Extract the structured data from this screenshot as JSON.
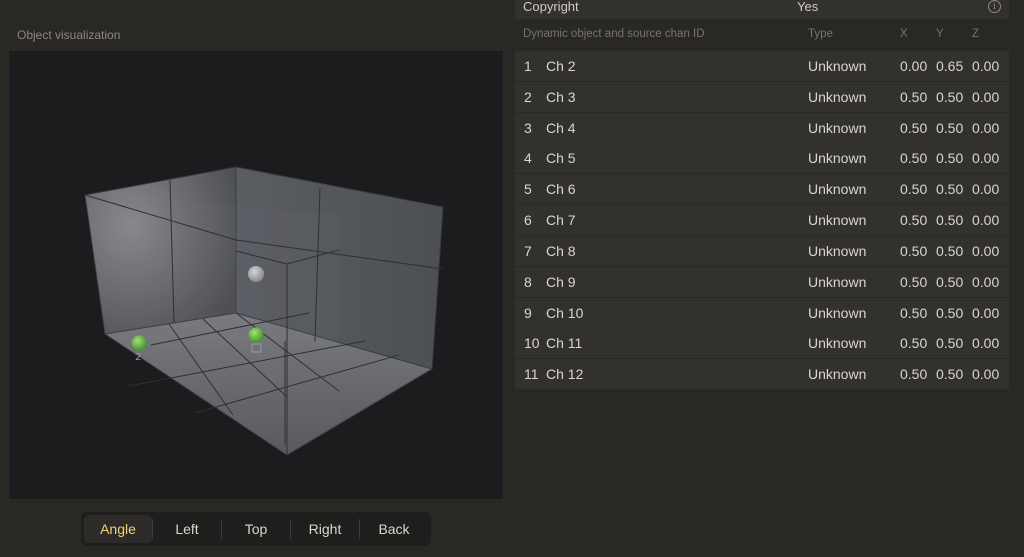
{
  "visualization": {
    "title": "Object visualization",
    "objects": [
      {
        "label": "2",
        "name": "object-2"
      },
      {
        "label": "⊞",
        "name": "object-center"
      }
    ]
  },
  "view_buttons": [
    {
      "label": "Angle",
      "active": true
    },
    {
      "label": "Left",
      "active": false
    },
    {
      "label": "Top",
      "active": false
    },
    {
      "label": "Right",
      "active": false
    },
    {
      "label": "Back",
      "active": false
    }
  ],
  "metadata_row": {
    "key": "Copyright",
    "value": "Yes",
    "icon": "info-icon"
  },
  "table": {
    "headers": {
      "id": "Dynamic object and source chan ID",
      "type": "Type",
      "x": "X",
      "y": "Y",
      "z": "Z"
    },
    "rows": [
      {
        "idx": "1",
        "name": "Ch 2",
        "type": "Unknown",
        "x": "0.00",
        "y": "0.65",
        "z": "0.00"
      },
      {
        "idx": "2",
        "name": "Ch 3",
        "type": "Unknown",
        "x": "0.50",
        "y": "0.50",
        "z": "0.00"
      },
      {
        "idx": "3",
        "name": "Ch 4",
        "type": "Unknown",
        "x": "0.50",
        "y": "0.50",
        "z": "0.00"
      },
      {
        "idx": "4",
        "name": "Ch 5",
        "type": "Unknown",
        "x": "0.50",
        "y": "0.50",
        "z": "0.00"
      },
      {
        "idx": "5",
        "name": "Ch 6",
        "type": "Unknown",
        "x": "0.50",
        "y": "0.50",
        "z": "0.00"
      },
      {
        "idx": "6",
        "name": "Ch 7",
        "type": "Unknown",
        "x": "0.50",
        "y": "0.50",
        "z": "0.00"
      },
      {
        "idx": "7",
        "name": "Ch 8",
        "type": "Unknown",
        "x": "0.50",
        "y": "0.50",
        "z": "0.00"
      },
      {
        "idx": "8",
        "name": "Ch 9",
        "type": "Unknown",
        "x": "0.50",
        "y": "0.50",
        "z": "0.00"
      },
      {
        "idx": "9",
        "name": "Ch 10",
        "type": "Unknown",
        "x": "0.50",
        "y": "0.50",
        "z": "0.00"
      },
      {
        "idx": "10",
        "name": "Ch 11",
        "type": "Unknown",
        "x": "0.50",
        "y": "0.50",
        "z": "0.00"
      },
      {
        "idx": "11",
        "name": "Ch 12",
        "type": "Unknown",
        "x": "0.50",
        "y": "0.50",
        "z": "0.00"
      }
    ]
  },
  "colors": {
    "active_view": "#f0d27a",
    "object_sphere": "#6fbf4a",
    "row_bg": "#33312e"
  }
}
